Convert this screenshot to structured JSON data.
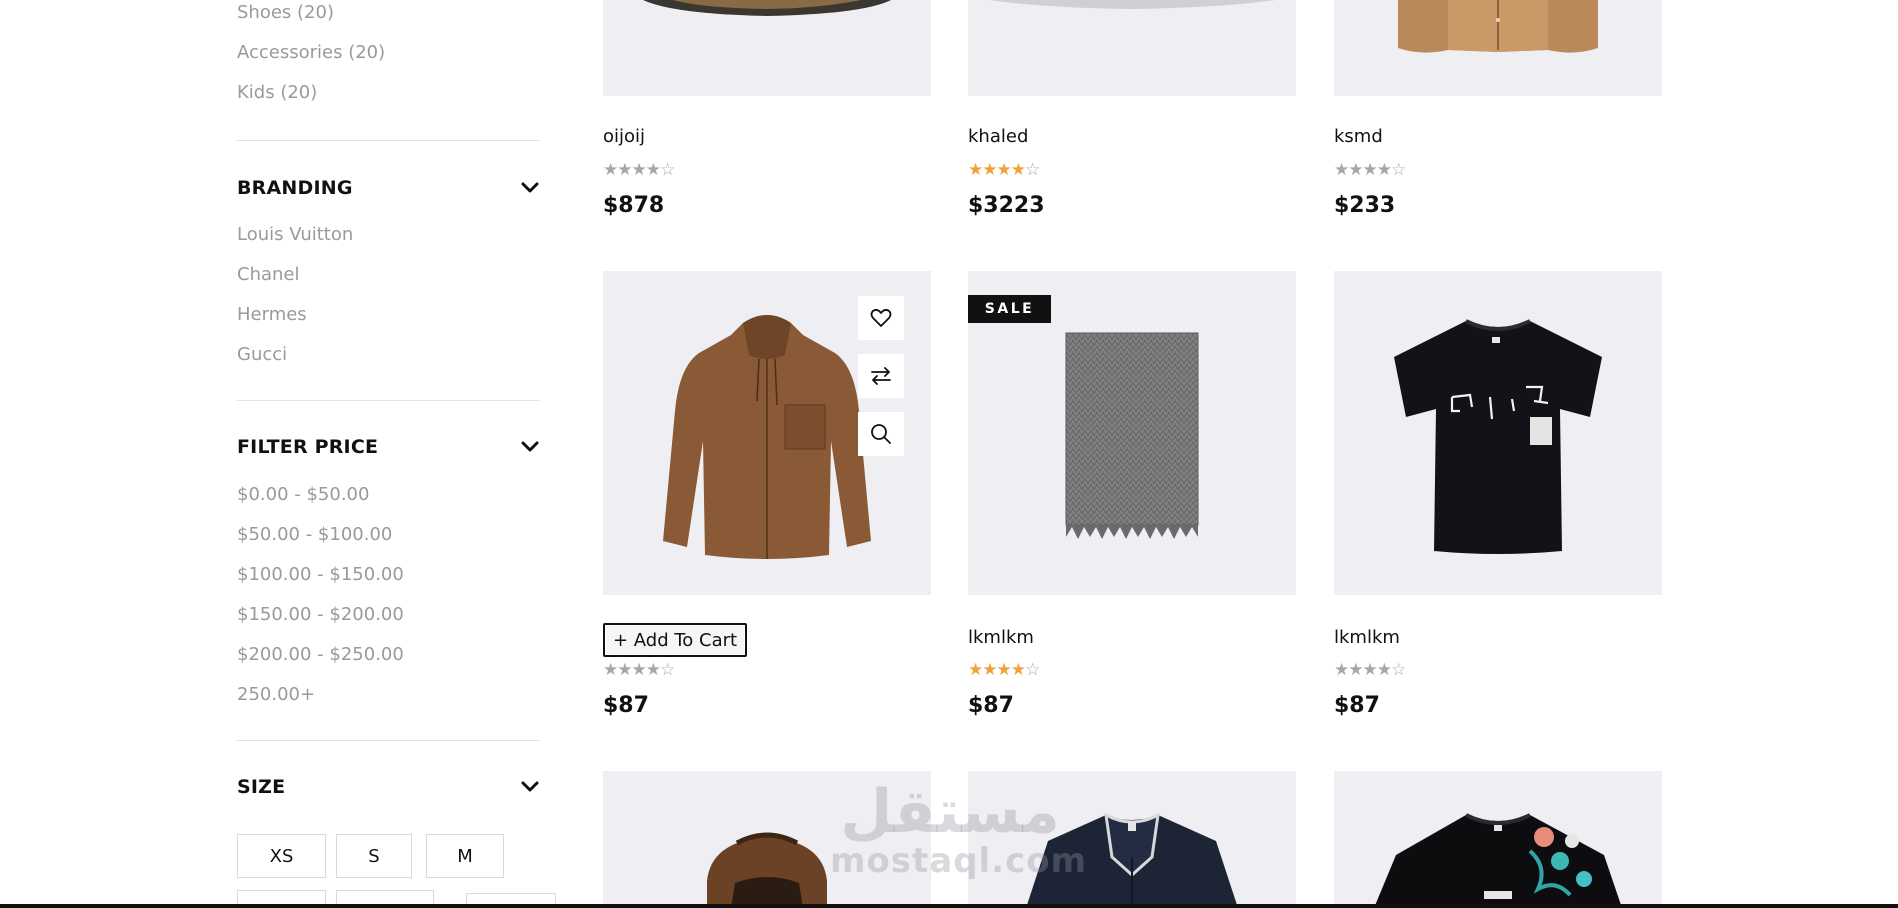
{
  "sidebar": {
    "categories": [
      "Shoes (20)",
      "Accessories (20)",
      "Kids (20)"
    ],
    "branding": {
      "title": "BRANDING",
      "items": [
        "Louis Vuitton",
        "Chanel",
        "Hermes",
        "Gucci"
      ]
    },
    "filter_price": {
      "title": "FILTER PRICE",
      "items": [
        "$0.00 - $50.00",
        "$50.00 - $100.00",
        "$100.00 - $150.00",
        "$150.00 - $200.00",
        "$200.00 - $250.00",
        "250.00+"
      ]
    },
    "size": {
      "title": "SIZE",
      "items": [
        "XS",
        "S",
        "M"
      ]
    }
  },
  "products": [
    {
      "name": "oijoij",
      "price": "$878",
      "rating": 4,
      "star_color": "grey",
      "image": "striped-shoe"
    },
    {
      "name": "khaled",
      "price": "$3223",
      "rating": 4,
      "star_color": "gold",
      "image": "white-product"
    },
    {
      "name": "ksmd",
      "price": "$233",
      "rating": 4,
      "star_color": "grey",
      "image": "tan-jacket"
    },
    {
      "name": "",
      "price": "$87",
      "rating": 4,
      "star_color": "grey",
      "image": "brown-hooded-shirt",
      "hovered": true,
      "add_to_cart": "+ Add To Cart"
    },
    {
      "name": "lkmlkm",
      "price": "$87",
      "rating": 4,
      "star_color": "gold",
      "image": "grey-scarf",
      "badge": "SALE"
    },
    {
      "name": "lkmlkm",
      "price": "$87",
      "rating": 4,
      "star_color": "grey",
      "image": "black-tshirt"
    },
    {
      "name": "",
      "price": "",
      "image": "brown-backpack"
    },
    {
      "name": "",
      "price": "",
      "image": "navy-polo"
    },
    {
      "name": "",
      "price": "",
      "image": "floral-tshirt"
    }
  ],
  "hover_actions": [
    "heart-icon",
    "compare-icon",
    "search-icon"
  ],
  "watermark": {
    "arabic": "مستقل",
    "latin": "mostaql.com"
  }
}
